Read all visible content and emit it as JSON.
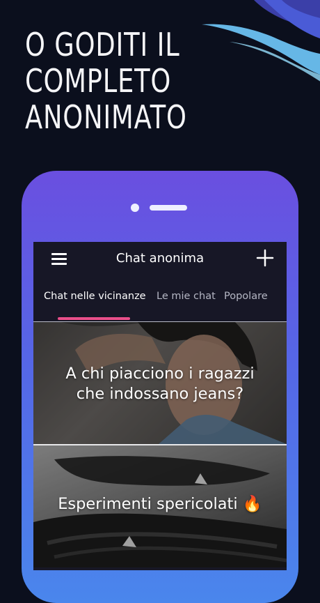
{
  "headline": {
    "line1": "O GODITI IL",
    "line2": "COMPLETO",
    "line3": "ANONIMATO"
  },
  "app": {
    "title": "Chat anonima",
    "tabs": [
      {
        "label": "Chat nelle vicinanze",
        "active": true
      },
      {
        "label": "Le mie chat",
        "active": false
      },
      {
        "label": "Popolare",
        "active": false
      }
    ]
  },
  "cards": [
    {
      "text_line1": "A chi piacciono i ragazzi",
      "text_line2": "che indossano jeans?"
    },
    {
      "text_line1": "Esperimenti spericolati 🔥"
    }
  ],
  "colors": {
    "background": "#0b0f1d",
    "phone_gradient_top": "#6a4fe0",
    "phone_gradient_bottom": "#4a86ec",
    "tab_indicator": "#ea4f8a",
    "screen_bg": "#171726"
  },
  "icons": {
    "menu": "hamburger-menu-icon",
    "add": "plus-icon"
  }
}
